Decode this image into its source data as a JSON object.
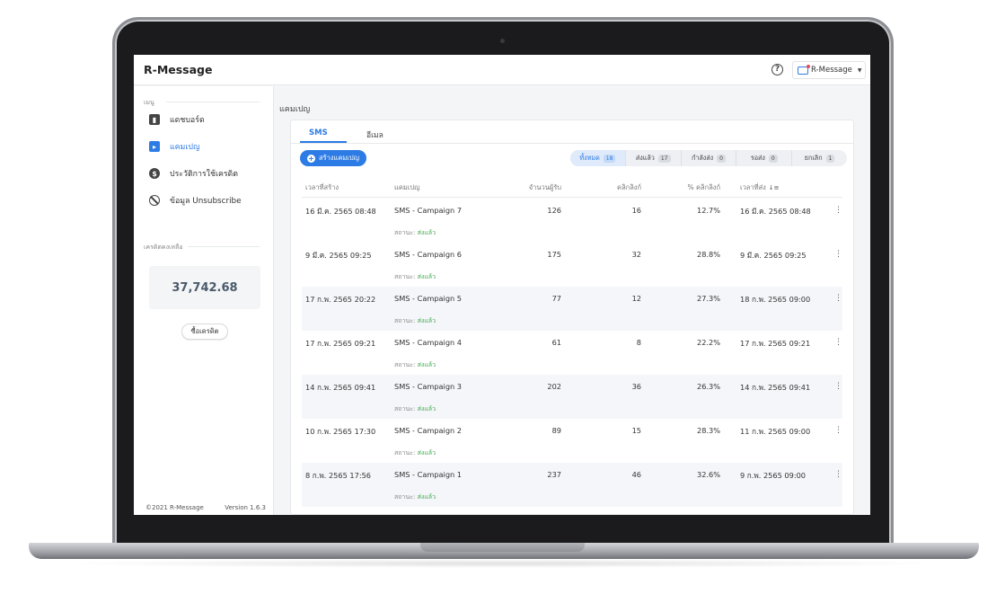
{
  "app": {
    "title": "R-Message"
  },
  "topbar": {
    "account_label": "R-Message",
    "help_icon": "question-circle-icon"
  },
  "sidebar": {
    "menu_heading": "เมนู",
    "items": [
      {
        "label": "แดชบอร์ด",
        "icon": "dashboard-icon"
      },
      {
        "label": "แคมเปญ",
        "icon": "campaign-icon",
        "active": true
      },
      {
        "label": "ประวัติการใช้เครดิต",
        "icon": "dollar-icon"
      },
      {
        "label": "ข้อมูล Unsubscribe",
        "icon": "block-icon"
      }
    ],
    "credit_heading": "เครดิตคงเหลือ",
    "credit_value": "37,742.68",
    "buy_label": "ซื้อเครดิต",
    "copyright": "©2021 R-Message",
    "version": "Version 1.6.3"
  },
  "main": {
    "page_title": "แคมเปญ",
    "tabs": [
      {
        "label": "SMS",
        "active": true
      },
      {
        "label": "อีเมล"
      }
    ],
    "create_label": "สร้างแคมเปญ",
    "filters": [
      {
        "label": "ทั้งหมด",
        "count": "18",
        "active": true
      },
      {
        "label": "ส่งแล้ว",
        "count": "17"
      },
      {
        "label": "กำลังส่ง",
        "count": "0"
      },
      {
        "label": "รอส่ง",
        "count": "0"
      },
      {
        "label": "ยกเลิก",
        "count": "1"
      }
    ],
    "columns": [
      "เวลาที่สร้าง",
      "แคมเปญ",
      "จำนวนผู้รับ",
      "คลิกลิงก์",
      "% คลิกลิงก์",
      "เวลาที่ส่ง"
    ],
    "status_prefix": "สถานะ:",
    "rows": [
      {
        "created": "16 มี.ค. 2565 08:48",
        "name": "SMS - Campaign 7",
        "recipients": "126",
        "clicks": "16",
        "pct": "12.7%",
        "sent": "16 มี.ค. 2565 08:48",
        "status": "ส่งแล้ว"
      },
      {
        "created": "9 มี.ค. 2565 09:25",
        "name": "SMS - Campaign 6",
        "recipients": "175",
        "clicks": "32",
        "pct": "28.8%",
        "sent": "9 มี.ค. 2565 09:25",
        "status": "ส่งแล้ว"
      },
      {
        "created": "17 ก.พ. 2565 20:22",
        "name": "SMS - Campaign 5",
        "recipients": "77",
        "clicks": "12",
        "pct": "27.3%",
        "sent": "18 ก.พ. 2565 09:00",
        "status": "ส่งแล้ว"
      },
      {
        "created": "17 ก.พ. 2565 09:21",
        "name": "SMS - Campaign 4",
        "recipients": "61",
        "clicks": "8",
        "pct": "22.2%",
        "sent": "17 ก.พ. 2565 09:21",
        "status": "ส่งแล้ว"
      },
      {
        "created": "14 ก.พ. 2565 09:41",
        "name": "SMS - Campaign 3",
        "recipients": "202",
        "clicks": "36",
        "pct": "26.3%",
        "sent": "14 ก.พ. 2565 09:41",
        "status": "ส่งแล้ว"
      },
      {
        "created": "10 ก.พ. 2565 17:30",
        "name": "SMS - Campaign 2",
        "recipients": "89",
        "clicks": "15",
        "pct": "28.3%",
        "sent": "11 ก.พ. 2565 09:00",
        "status": "ส่งแล้ว"
      },
      {
        "created": "8 ก.พ. 2565 17:56",
        "name": "SMS - Campaign 1",
        "recipients": "237",
        "clicks": "46",
        "pct": "32.6%",
        "sent": "9 ก.พ. 2565 09:00",
        "status": "ส่งแล้ว"
      }
    ]
  },
  "colors": {
    "accent": "#2d7be5",
    "status_sent": "#3ea84b"
  }
}
